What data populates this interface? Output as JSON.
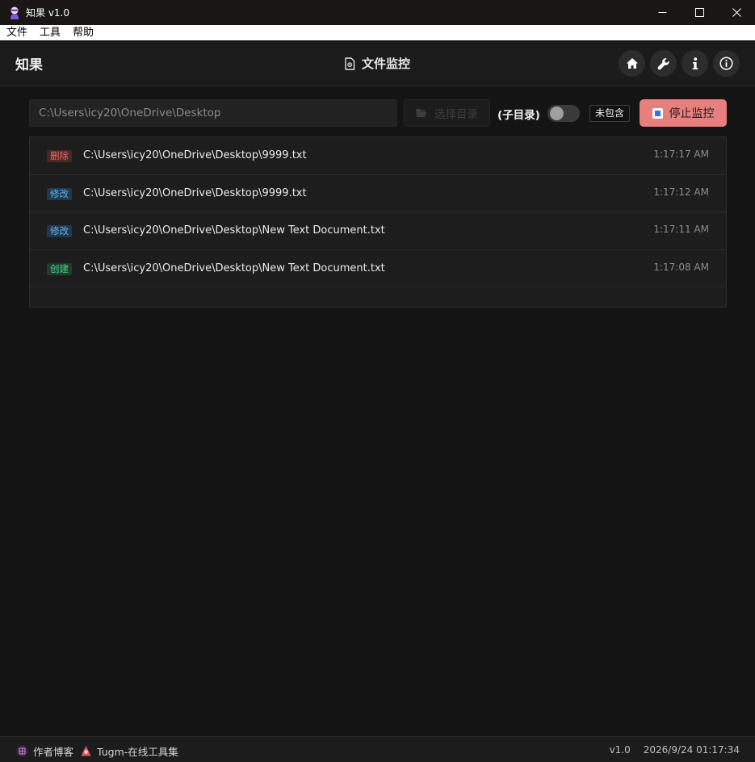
{
  "window": {
    "title": "知果 v1.0",
    "controls": {
      "minimize": "—",
      "maximize": "☐",
      "close": "✕"
    }
  },
  "menu": {
    "items": [
      {
        "label": "文件"
      },
      {
        "label": "工具"
      },
      {
        "label": "帮助"
      }
    ]
  },
  "header": {
    "brand": "知果",
    "page_title": "文件监控",
    "actions": [
      {
        "icon": "home-icon"
      },
      {
        "icon": "wrench-icon"
      },
      {
        "icon": "info-icon"
      },
      {
        "icon": "info-circle-icon"
      }
    ]
  },
  "toolbar": {
    "path_value": "C:\\Users\\icy20\\OneDrive\\Desktop",
    "select_dir_label": "选择目录",
    "subdir_label": "(子目录)",
    "subdir_enabled": false,
    "include_tag": "未包含",
    "stop_label": "停止监控"
  },
  "events": [
    {
      "type": "删除",
      "kind": "delete",
      "path": "C:\\Users\\icy20\\OneDrive\\Desktop\\9999.txt",
      "time": "1:17:17 AM"
    },
    {
      "type": "修改",
      "kind": "modify",
      "path": "C:\\Users\\icy20\\OneDrive\\Desktop\\9999.txt",
      "time": "1:17:12 AM"
    },
    {
      "type": "修改",
      "kind": "modify",
      "path": "C:\\Users\\icy20\\OneDrive\\Desktop\\New Text Document.txt",
      "time": "1:17:11 AM"
    },
    {
      "type": "创建",
      "kind": "create",
      "path": "C:\\Users\\icy20\\OneDrive\\Desktop\\New Text Document.txt",
      "time": "1:17:08 AM"
    }
  ],
  "status": {
    "blog_label": "作者博客",
    "tools_label": "Tugm-在线工具集",
    "version": "v1.0",
    "datetime": "2026/9/24 01:17:34"
  },
  "colors": {
    "background": "#141414",
    "stop_button": "#e87f7f",
    "tag_delete": "#ee6b6b",
    "tag_modify": "#5fb2ee",
    "tag_create": "#49d190"
  }
}
